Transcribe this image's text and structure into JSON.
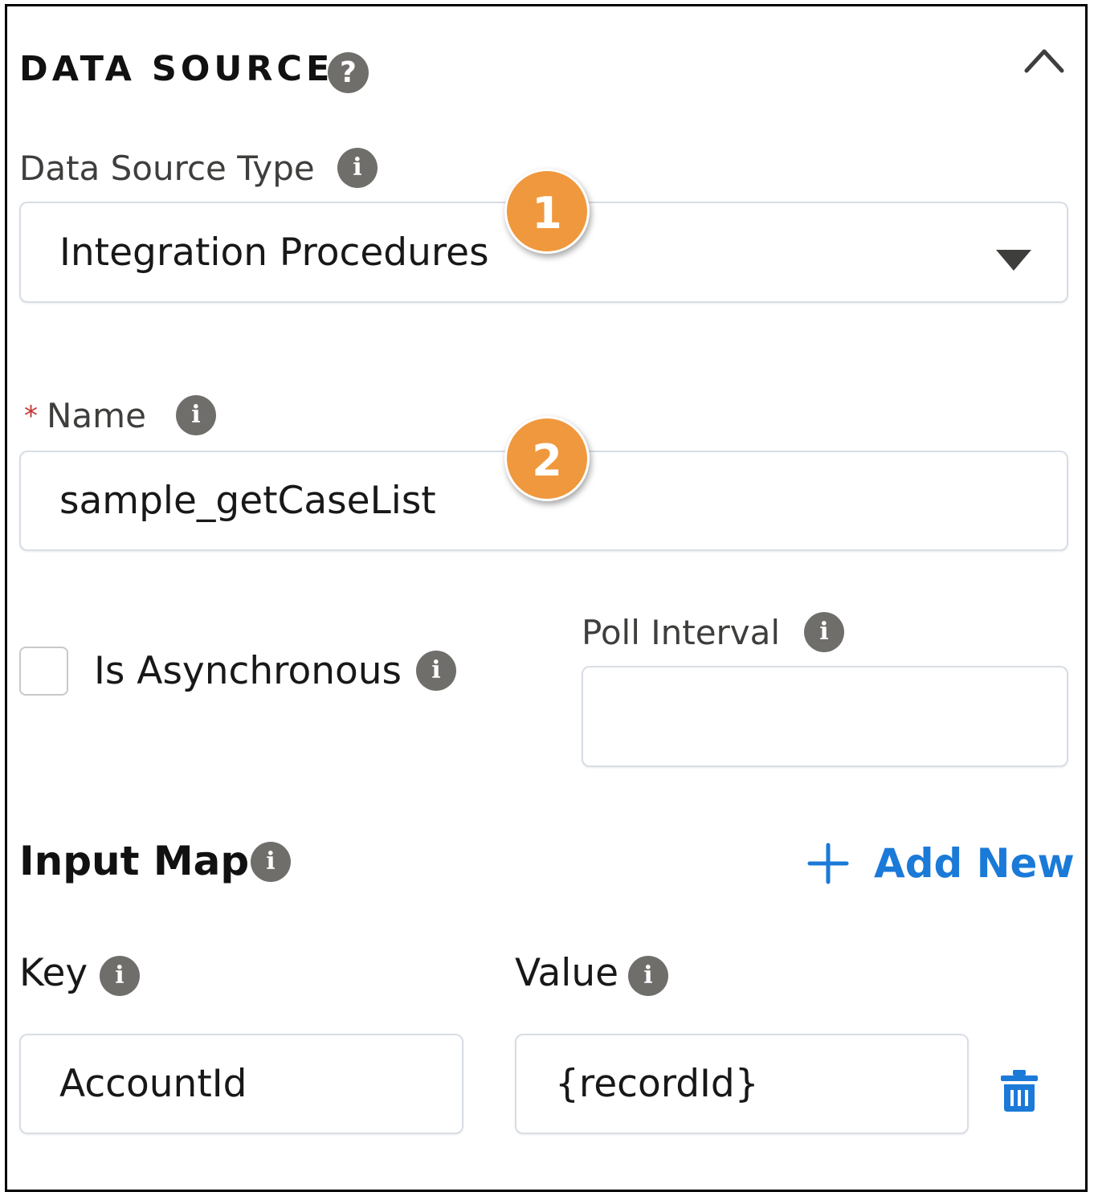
{
  "panel": {
    "title": "DATA SOURCE",
    "help_glyph": "?",
    "collapse_icon": "chevron-up-icon"
  },
  "data_source_type": {
    "label": "Data Source Type",
    "value": "Integration Procedures",
    "info_glyph": "i"
  },
  "name": {
    "required_mark": "*",
    "label": "Name",
    "value": "sample_getCaseList",
    "info_glyph": "i"
  },
  "is_asynchronous": {
    "label": "Is Asynchronous",
    "checked": false,
    "info_glyph": "i"
  },
  "poll_interval": {
    "label": "Poll Interval",
    "value": "",
    "info_glyph": "i"
  },
  "input_map": {
    "title": "Input Map",
    "info_glyph": "i",
    "add_new_label": "Add New",
    "key_label": "Key",
    "value_label": "Value",
    "rows": [
      {
        "key": "AccountId",
        "value": "{recordId}"
      }
    ]
  },
  "callouts": [
    "1",
    "2"
  ],
  "colors": {
    "callout": "#f0983d",
    "link": "#1b7ad8",
    "icon_gray": "#706e6b",
    "required": "#c23934"
  }
}
